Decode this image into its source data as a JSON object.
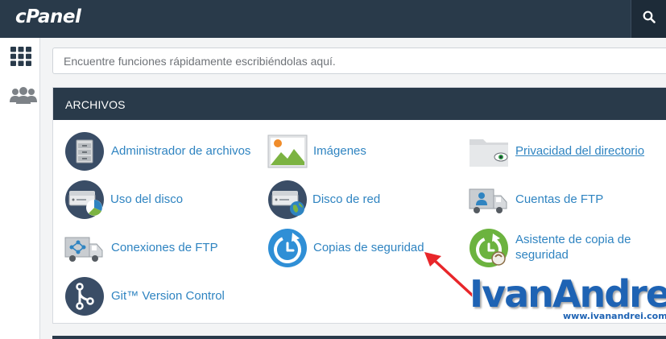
{
  "header": {
    "logo": "cPanel",
    "search_icon": "search-icon"
  },
  "sidebar": {
    "items": [
      {
        "icon": "grid-apps-icon"
      },
      {
        "icon": "users-icon"
      }
    ]
  },
  "search": {
    "placeholder": "Encuentre funciones rápidamente escribiéndolas aquí."
  },
  "section": {
    "title": "ARCHIVOS",
    "items": [
      {
        "label": "Administrador de archivos",
        "icon": "file-manager-icon"
      },
      {
        "label": "Imágenes",
        "icon": "images-icon"
      },
      {
        "label": "Privacidad del directorio",
        "icon": "directory-privacy-icon"
      },
      {
        "label": "Uso del disco",
        "icon": "disk-usage-icon"
      },
      {
        "label": "Disco de red",
        "icon": "network-disk-icon"
      },
      {
        "label": "Cuentas de FTP",
        "icon": "ftp-accounts-icon"
      },
      {
        "label": "Conexiones de FTP",
        "icon": "ftp-connections-icon"
      },
      {
        "label": "Copias de seguridad",
        "icon": "backup-icon"
      },
      {
        "label": "Asistente de copia de",
        "label2": "seguridad",
        "icon": "backup-wizard-icon"
      },
      {
        "label": "Git™ Version Control",
        "icon": "git-icon"
      }
    ]
  },
  "watermark": {
    "name": "IvanAndrei",
    "url": "www.ivanandrei.com"
  },
  "colors": {
    "header_bg": "#293a4a",
    "link": "#2f84c1",
    "icon_circle": "#3a4d66",
    "arrow": "#e8262a"
  }
}
